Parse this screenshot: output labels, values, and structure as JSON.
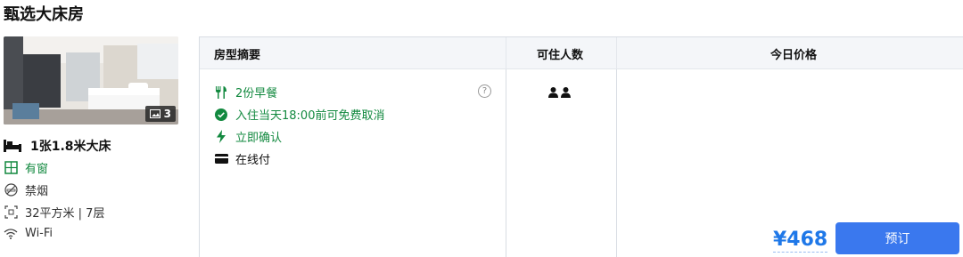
{
  "room": {
    "title": "甄选大床房",
    "photo_count": "3",
    "bed": "1张1.8米大床",
    "features": [
      {
        "icon": "window-icon",
        "text": "有窗",
        "color": "#12893f"
      },
      {
        "icon": "no-smoking-icon",
        "text": "禁烟",
        "color": "#333333"
      },
      {
        "icon": "area-icon",
        "text": "32平方米 | 7层",
        "color": "#333333"
      },
      {
        "icon": "wifi-icon",
        "text": "Wi-Fi",
        "color": "#333333"
      }
    ]
  },
  "table": {
    "headers": [
      "房型摘要",
      "可住人数",
      "今日价格"
    ],
    "benefits": [
      {
        "icon": "dining-icon",
        "text": "2份早餐",
        "color": "#12893f"
      },
      {
        "icon": "check-circle-icon",
        "text": "入住当天18:00前可免费取消",
        "color": "#12893f"
      },
      {
        "icon": "lightning-icon",
        "text": "立即确认",
        "color": "#12893f"
      },
      {
        "icon": "card-icon",
        "text": "在线付",
        "color": "#111111"
      }
    ],
    "occupancy": 2,
    "price": "¥468",
    "book_label": "预订"
  },
  "colors": {
    "accent": "#3a78ee",
    "price": "#1f78e8",
    "green": "#12893f"
  }
}
